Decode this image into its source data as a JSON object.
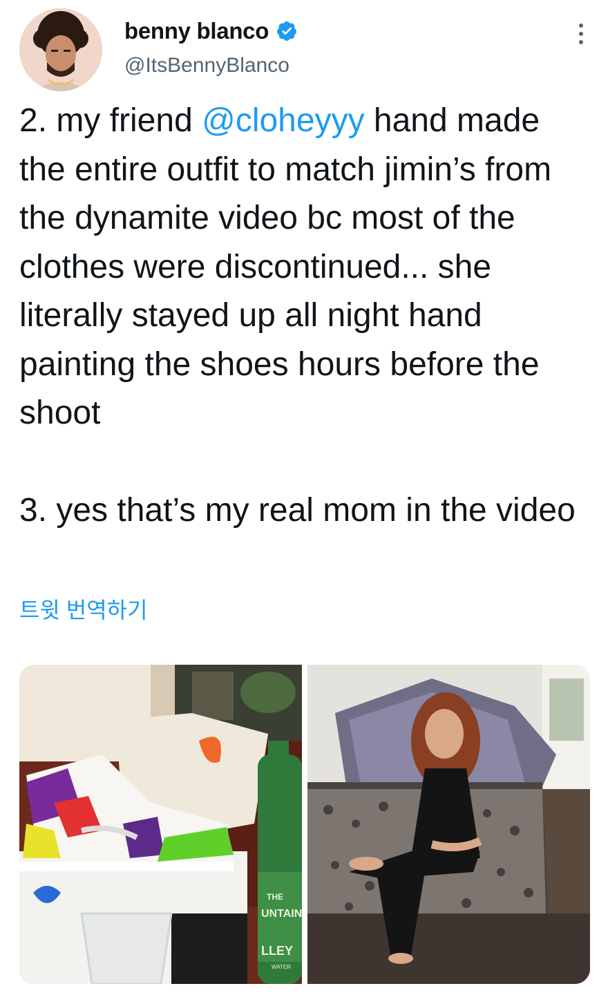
{
  "tweet": {
    "author": {
      "display_name": "benny blanco",
      "handle": "@ItsBennyBlanco",
      "verified": true
    },
    "text_before_mention": "2. my friend ",
    "mention": "@cloheyyy",
    "text_after_mention": " hand made the entire outfit to match jimin’s from the dynamite video bc most of the clothes were discontinued... she literally stayed up all night hand painting the shoes hours before the shoot\n\n3. yes that’s my real mom in the video",
    "translate_label": "트윗 번역하기",
    "media": [
      {
        "icon": "sneaker-photo",
        "bottle_label_1": "THE",
        "bottle_label_2": "UNTAIN",
        "bottle_label_3": "LLEY",
        "bottle_label_4": "WATER"
      },
      {
        "icon": "woman-on-couch-photo"
      }
    ]
  },
  "colors": {
    "accent": "#1d9bf0",
    "text": "#0f1419",
    "secondary": "#536471"
  }
}
